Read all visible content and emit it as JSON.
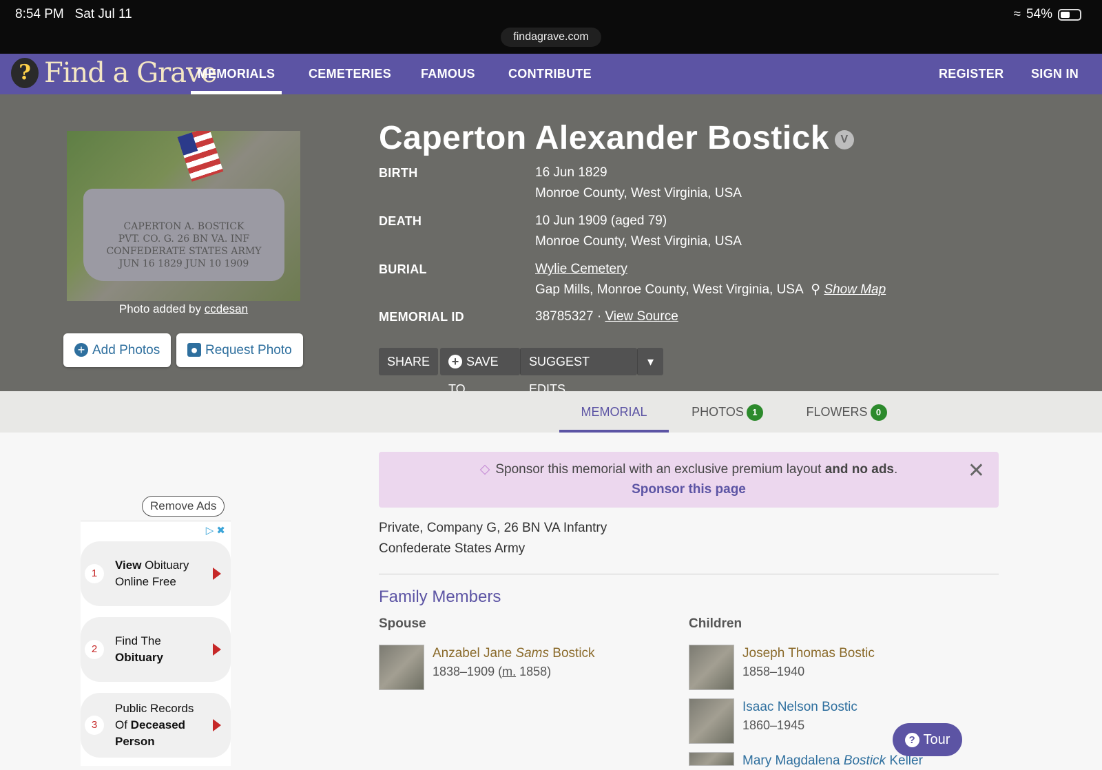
{
  "status_bar": {
    "time": "8:54 PM",
    "date": "Sat Jul 11",
    "battery": "54%",
    "url": "findagrave.com"
  },
  "nav": {
    "logo_text": "Find a Grave",
    "items": [
      "MEMORIALS",
      "CEMETERIES",
      "FAMOUS",
      "CONTRIBUTE"
    ],
    "register": "REGISTER",
    "sign_in": "SIGN IN"
  },
  "memorial": {
    "name": "Caperton Alexander Bostick",
    "badge": "V",
    "birth_label": "BIRTH",
    "birth_date": "16 Jun 1829",
    "birth_place": "Monroe County, West Virginia, USA",
    "death_label": "DEATH",
    "death_date": "10 Jun 1909 (aged 79)",
    "death_place": "Monroe County, West Virginia, USA",
    "burial_label": "BURIAL",
    "cemetery": "Wylie Cemetery",
    "burial_place": "Gap Mills, Monroe County, West Virginia, USA",
    "show_map": "Show Map",
    "id_label": "MEMORIAL ID",
    "id_value": "38785327 ·",
    "view_source": "View Source"
  },
  "photo": {
    "stone_lines": [
      "CAPERTON A. BOSTICK",
      "PVT. CO. G. 26 BN VA. INF",
      "CONFEDERATE STATES ARMY",
      "JUN 16 1829 JUN 10 1909"
    ],
    "credit_prefix": "Photo added by",
    "credit_user": "ccdesan",
    "add_photos": "Add Photos",
    "request_photo": "Request Photo"
  },
  "actions": {
    "share": "SHARE",
    "save_to": "SAVE TO",
    "suggest_edits": "SUGGEST EDITS"
  },
  "tabs": [
    {
      "label": "MEMORIAL",
      "count": ""
    },
    {
      "label": "PHOTOS",
      "count": "1"
    },
    {
      "label": "FLOWERS",
      "count": "0"
    }
  ],
  "banner": {
    "text": "Sponsor this memorial with an exclusive premium layout",
    "text_bold": "and no ads",
    "text_end": ".",
    "link": "Sponsor this page"
  },
  "bio": {
    "line1": "Private, Company G, 26 BN VA Infantry",
    "line2": "Confederate States Army"
  },
  "family": {
    "heading": "Family Members",
    "spouse_heading": "Spouse",
    "children_heading": "Children",
    "spouse": {
      "first": "Anzabel Jane",
      "maiden": "Sams",
      "last": "Bostick",
      "dates": "1838–1909",
      "marriage_abbr": "m.",
      "marriage_year": "1858"
    },
    "children": [
      {
        "name": "Joseph Thomas Bostic",
        "dates": "1858–1940"
      },
      {
        "name": "Isaac Nelson Bostic",
        "dates": "1860–1945"
      },
      {
        "name_first": "Mary Magdalena",
        "name_maiden": "Bostick",
        "name_last": "Keller",
        "dates": ""
      }
    ]
  },
  "ads": {
    "remove_ads": "Remove Ads",
    "items": [
      {
        "num": "1",
        "line1_bold": "View",
        "line1": "Obituary",
        "line2": "Online Free",
        "line3": ""
      },
      {
        "num": "2",
        "line1_bold": "",
        "line1": "Find The",
        "line2": "Obituary",
        "line3": ""
      },
      {
        "num": "3",
        "line1_bold": "",
        "line1": "Public Records",
        "line2": "Of Deceased",
        "line3": "Person"
      }
    ]
  },
  "tour": "Tour",
  "colors": {
    "brand": "#5c54a4",
    "hero_bg": "#6b6b67",
    "sponsor_bg": "#ecd7ee",
    "count_badge": "#2c8a2c"
  }
}
